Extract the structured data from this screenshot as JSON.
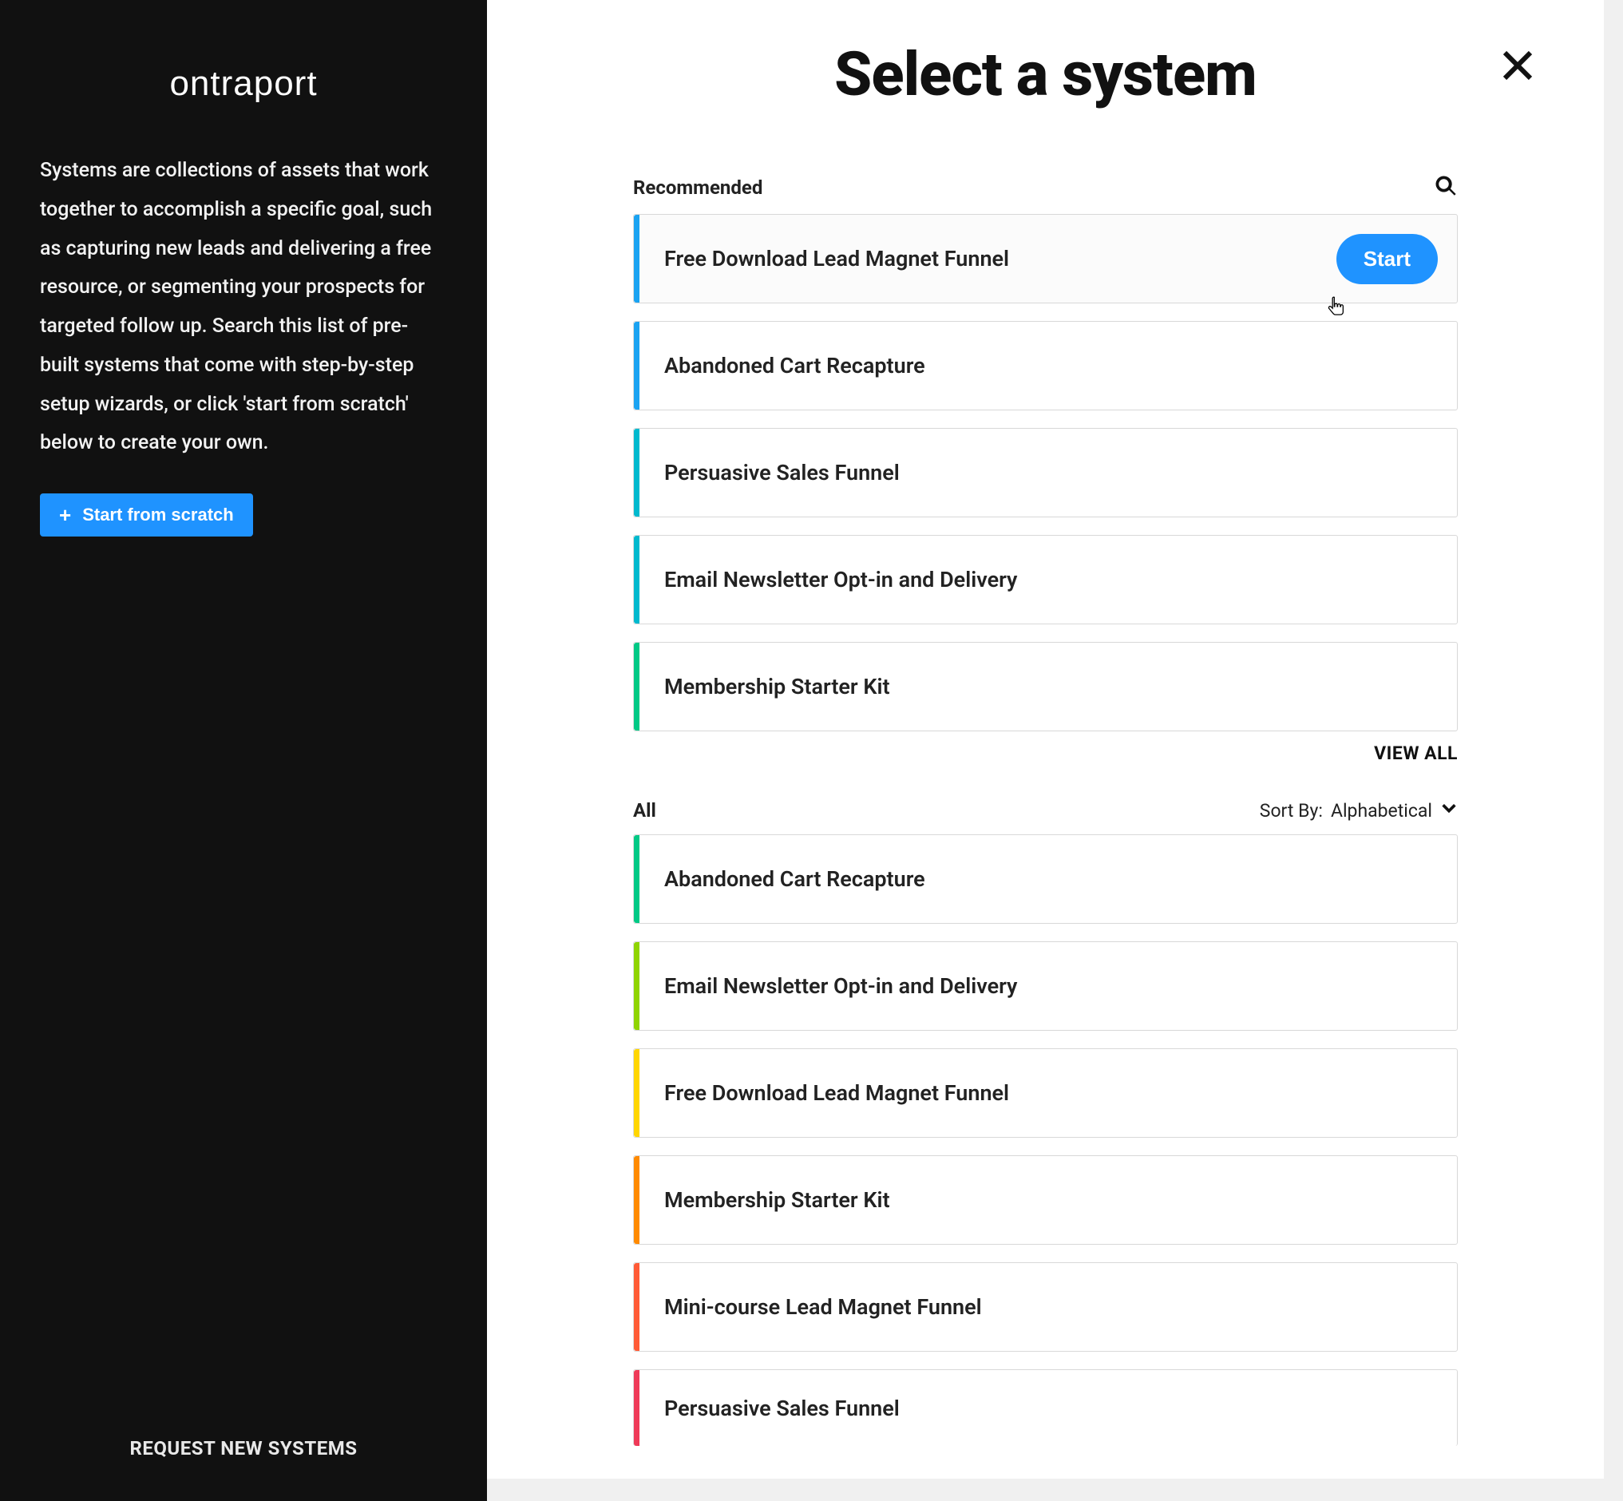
{
  "brand": {
    "logo_text": "ontraport"
  },
  "sidebar": {
    "description": "Systems are collections of assets that work together to accomplish a specific goal, such as capturing new leads and delivering a free resource, or segmenting your prospects for targeted follow up. Search this list of pre-built systems that come with step-by-step setup wizards, or click 'start from scratch' below to create your own.",
    "start_from_scratch_label": "Start from scratch",
    "request_link": "REQUEST NEW SYSTEMS"
  },
  "main": {
    "title": "Select a system",
    "recommended_label": "Recommended",
    "view_all_label": "VIEW ALL",
    "all_label": "All",
    "sort_by_label": "Sort By:",
    "sort_value": "Alphabetical",
    "start_button_label": "Start"
  },
  "recommended": [
    {
      "title": "Free Download Lead Magnet Funnel",
      "accent": "blue",
      "hovered": true
    },
    {
      "title": "Abandoned Cart Recapture",
      "accent": "blue"
    },
    {
      "title": "Persuasive Sales Funnel",
      "accent": "cyan"
    },
    {
      "title": "Email Newsletter Opt-in and Delivery",
      "accent": "cyan"
    },
    {
      "title": "Membership Starter Kit",
      "accent": "green"
    }
  ],
  "all_items": [
    {
      "title": "Abandoned Cart Recapture",
      "accent": "green"
    },
    {
      "title": "Email Newsletter Opt-in and Delivery",
      "accent": "lime"
    },
    {
      "title": "Free Download Lead Magnet Funnel",
      "accent": "yellow"
    },
    {
      "title": "Membership Starter Kit",
      "accent": "orange"
    },
    {
      "title": "Mini-course Lead Magnet Funnel",
      "accent": "redorange"
    },
    {
      "title": "Persuasive Sales Funnel",
      "accent": "red"
    }
  ]
}
